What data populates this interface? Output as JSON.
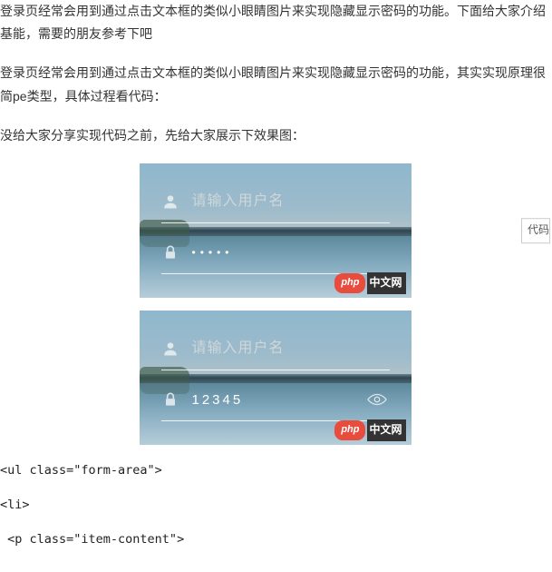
{
  "article": {
    "intro": "登录页经常会用到通过点击文本框的类似小眼睛图片来实现隐藏显示密码的功能。下面给大家介绍基能，需要的朋友参考下吧",
    "desc": "登录页经常会用到通过点击文本框的类似小眼睛图片来实现隐藏显示密码的功能，其实实现原理很简pe类型，具体过程看代码：",
    "preview": "没给大家分享实现代码之前，先给大家展示下效果图："
  },
  "demo1": {
    "username_placeholder": "请输入用户名",
    "password_masked": "•••••"
  },
  "demo2": {
    "username_placeholder": "请输入用户名",
    "password_plain": "12345"
  },
  "watermark": {
    "pill": "php",
    "brand": "中文网"
  },
  "side_button": "代码",
  "code": {
    "line1": "<ul class=\"form-area\">",
    "line2": "<li>",
    "line3": " <p class=\"item-content\">"
  }
}
